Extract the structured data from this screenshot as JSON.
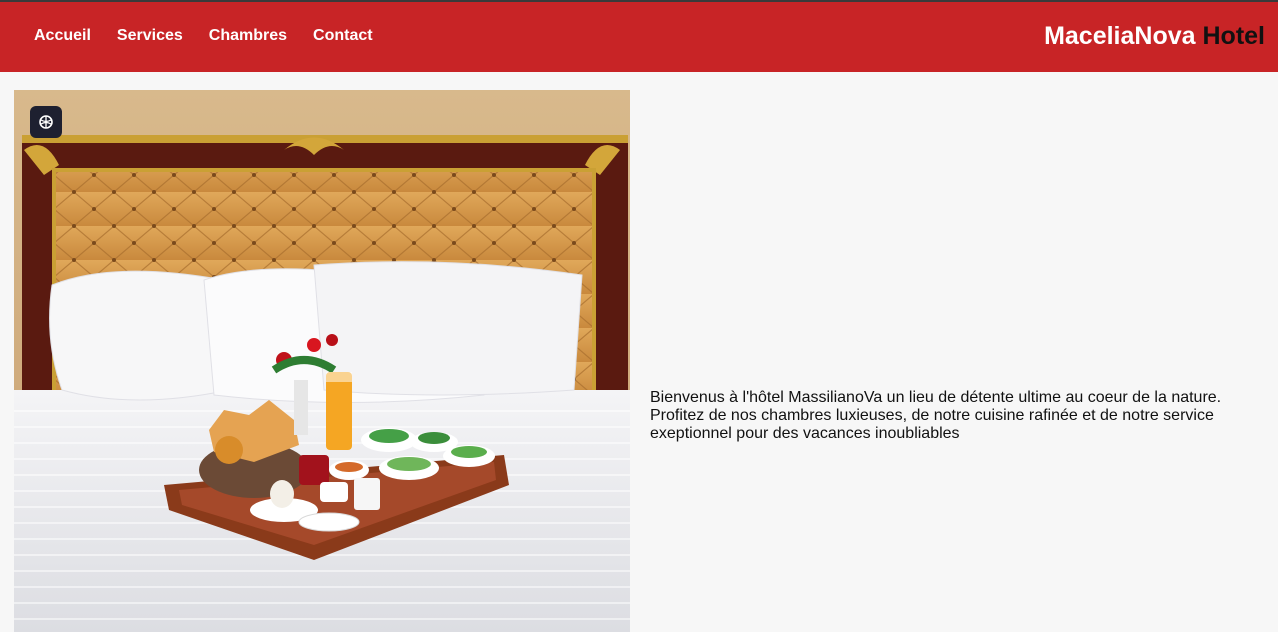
{
  "nav": {
    "items": [
      {
        "label": "Accueil"
      },
      {
        "label": "Services"
      },
      {
        "label": "Chambres"
      },
      {
        "label": "Contact"
      }
    ]
  },
  "brand": {
    "part1": "MaceliaNova",
    "part2": "Hotel"
  },
  "hero": {
    "image_icon": "brain-icon",
    "image_subject": "bed-with-breakfast-tray-photo"
  },
  "intro": {
    "text": "Bienvenus à l'hôtel MassilianoVa un lieu de détente ultime au coeur de la nature. Profitez de nos chambres luxieuses, de notre cuisine rafinée et de notre service exeptionnel pour des vacances inoubliables"
  },
  "colors": {
    "header": "#c82426",
    "background": "#f7f7f7",
    "nav_text": "#ffffff",
    "brand_accent": "#111111"
  }
}
